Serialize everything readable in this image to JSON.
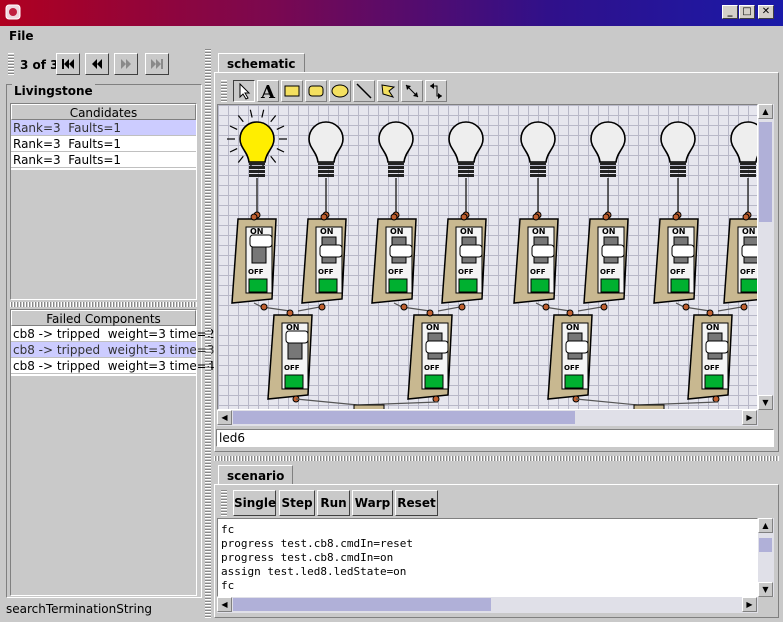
{
  "menu": {
    "file": "File"
  },
  "nav": {
    "counter": "3 of 3"
  },
  "livingstone": {
    "title": "Livingstone",
    "candidates": {
      "header": "Candidates",
      "rows": [
        "Rank=3  Faults=1",
        "Rank=3  Faults=1",
        "Rank=3  Faults=1"
      ]
    },
    "failed": {
      "header": "Failed Components",
      "rows": [
        "cb8 -> tripped  weight=3 time=2",
        "cb8 -> tripped  weight=3 time=3",
        "cb8 -> tripped  weight=3 time=4"
      ]
    },
    "status": "searchTerminationString"
  },
  "schematic": {
    "tab": "schematic",
    "status": "led6",
    "switch_on": "ON",
    "switch_off": "OFF"
  },
  "scenario": {
    "tab": "scenario",
    "buttons": [
      "Single",
      "Step",
      "Run",
      "Warp",
      "Reset"
    ],
    "lines": [
      "fc",
      "progress test.cb8.cmdIn=reset",
      "progress test.cb8.cmdIn=on",
      "assign test.led8.ledState=on",
      "fc"
    ]
  },
  "colors": {
    "accent": "#ccccff",
    "bulb_on": "#ffee00",
    "switch_green": "#00b030"
  },
  "icons": [
    "app-icon",
    "first-icon",
    "prev-icon",
    "next-icon",
    "last-icon",
    "arrow-tool-icon",
    "text-tool-icon",
    "rect-tool-icon",
    "round-rect-tool-icon",
    "ellipse-tool-icon",
    "line-tool-icon",
    "polygon-tool-icon",
    "connector-tool-icon",
    "elbow-connector-tool-icon"
  ]
}
